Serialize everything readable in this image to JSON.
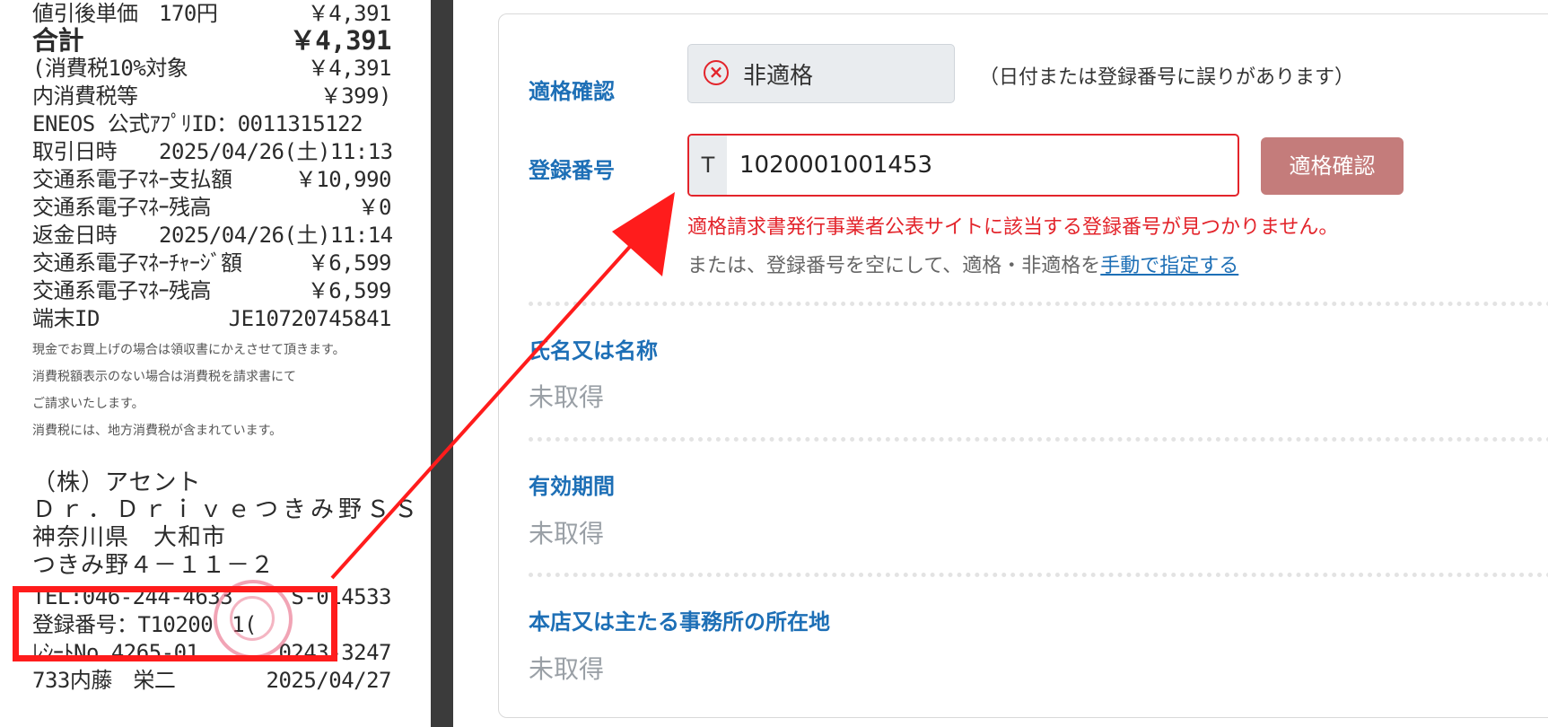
{
  "receipt": {
    "lines": [
      {
        "left": "値引後単価　170円",
        "right": "￥4,391"
      },
      {
        "left": "合計",
        "right": "￥4,391"
      },
      {
        "left": "(消費税10%対象",
        "right": "￥4,391"
      },
      {
        "left": " 内消費税等",
        "right": "￥399)"
      },
      {
        "left": "ENEOS 公式ｱﾌﾟﾘID：0011315122",
        "right": ""
      },
      {
        "left": "取引日時　　2025/04/26(土)11:13",
        "right": ""
      },
      {
        "left": "交通系電子ﾏﾈｰ支払額",
        "right": "￥10,990"
      },
      {
        "left": "交通系電子ﾏﾈｰ残高",
        "right": "￥0"
      },
      {
        "left": "返金日時　　2025/04/26(土)11:14",
        "right": ""
      },
      {
        "left": "交通系電子ﾏﾈｰﾁｬｰｼﾞ額",
        "right": "￥6,599"
      },
      {
        "left": "交通系電子ﾏﾈｰ残高",
        "right": "￥6,599"
      },
      {
        "left": "端末ID",
        "right": "JE10720745841"
      }
    ],
    "notes": [
      "現金でお買上げの場合は領収書にかえさせて頂きます。",
      "消費税額表示のない場合は消費税を請求書にて",
      "ご請求いたします。",
      "消費税には、地方消費税が含まれています。"
    ],
    "company": "（株）アセント",
    "store": "Ｄｒ．Ｄｒｉｖｅつきみ野ＳＳ",
    "address1": "神奈川県　大和市",
    "address2": "つきみ野４－１１－２",
    "tel_left": "TEL:046-244-4633",
    "tel_right": "S-014533",
    "registration_left": "登録番号：T10200",
    "registration_right": "1(",
    "receipt_no_left": "ﾚｼｰﾄNo 4265-01",
    "receipt_no_right": "0243-3247",
    "staff": "733内藤　栄二",
    "date": "2025/04/27"
  },
  "panel": {
    "eligibility": {
      "label": "適格確認",
      "status": "非適格",
      "status_icon": "x-circle-icon",
      "note": "（日付または登録番号に誤りがあります）"
    },
    "registration": {
      "label": "登録番号",
      "prefix": "T",
      "value": "1020001001453",
      "button_label": "適格確認",
      "error": "適格請求書発行事業者公表サイトに該当する登録番号が見つかりません。",
      "manual_text": "または、登録番号を空にして、適格・非適格を",
      "manual_link": "手動で指定する"
    },
    "fields": [
      {
        "label": "氏名又は名称",
        "value": "未取得"
      },
      {
        "label": "有効期間",
        "value": "未取得"
      },
      {
        "label": "本店又は主たる事務所の所在地",
        "value": "未取得"
      }
    ]
  },
  "colors": {
    "accent_blue": "#1d6fb6",
    "error_red": "#e3242b",
    "annotation_red": "#ff1c1c",
    "button_disabled": "#c47c7b"
  }
}
